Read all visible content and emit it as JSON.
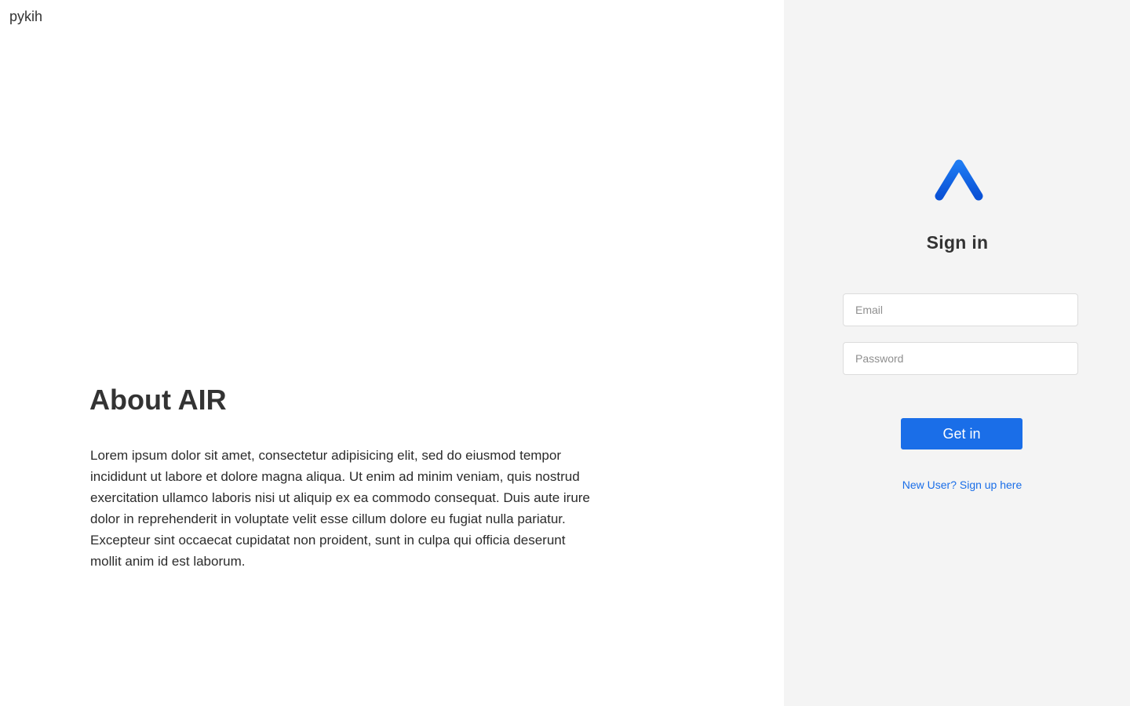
{
  "header": {
    "brand": "pykih"
  },
  "about": {
    "title": "About AIR",
    "body": "Lorem ipsum dolor sit amet, consectetur adipisicing elit, sed do eiusmod tempor incididunt ut labore et dolore magna aliqua. Ut enim ad minim veniam, quis nostrud exercitation ullamco laboris nisi ut aliquip ex ea commodo consequat. Duis aute irure dolor in reprehenderit in voluptate velit esse cillum dolore eu fugiat nulla pariatur. Excepteur sint occaecat cupidatat non proident, sunt in culpa qui officia deserunt mollit anim id est laborum."
  },
  "signin": {
    "logo_icon": "air-logo-icon",
    "title": "Sign in",
    "email": {
      "placeholder": "Email",
      "value": ""
    },
    "password": {
      "placeholder": "Password",
      "value": ""
    },
    "submit_label": "Get in",
    "signup_link": "New User? Sign up here"
  },
  "colors": {
    "accent": "#1a6ee8",
    "panel_bg": "#f4f4f4",
    "text": "#333333"
  }
}
